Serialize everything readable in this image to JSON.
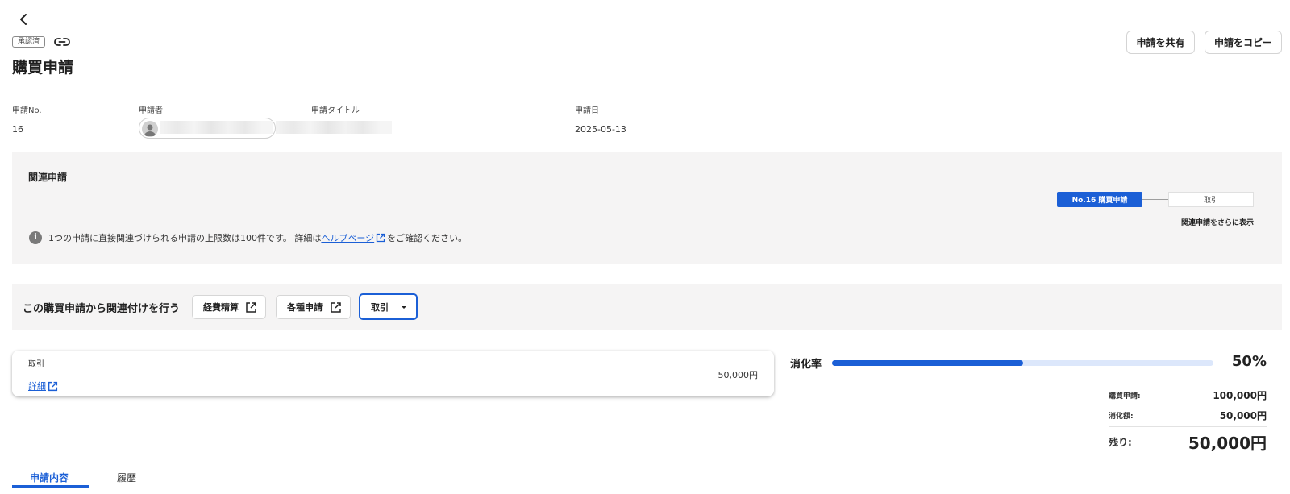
{
  "header": {
    "status_badge": "承認済",
    "title": "購買申請",
    "share_button": "申請を共有",
    "copy_button": "申請をコピー"
  },
  "meta": {
    "number_label": "申請No.",
    "number_value": "16",
    "applicant_label": "申請者",
    "title_label": "申請タイトル",
    "date_label": "申請日",
    "date_value": "2025-05-13"
  },
  "related": {
    "title": "関連申請",
    "chain": [
      "No.16 購買申請",
      "取引"
    ],
    "show_more": "関連申請をさらに表示",
    "info_text_before": "1つの申請に直接関連づけられる申請の上限数は100件です。 詳細は",
    "info_link": "ヘルプページ",
    "info_text_after": "をご確認ください。"
  },
  "link_panel": {
    "label": "この購買申請から関連付けを行う",
    "buttons": {
      "expense": "経費精算",
      "misc": "各種申請",
      "deal": "取引"
    }
  },
  "deal_card": {
    "title": "取引",
    "detail_link": "詳細",
    "amount": "50,000円"
  },
  "consumption": {
    "label": "消化率",
    "rate_text": "50%",
    "rate_fraction": 0.5,
    "rows": [
      {
        "label": "購買申請:",
        "value": "100,000円"
      },
      {
        "label": "消化額:",
        "value": "50,000円"
      }
    ],
    "remaining_label": "残り:",
    "remaining_value": "50,000円"
  },
  "tabs": {
    "content": "申請内容",
    "history": "履歴"
  },
  "colors": {
    "accent": "#1b5fd6",
    "panel_bg": "#f5f4f4",
    "progress_track": "#dce7fb"
  }
}
